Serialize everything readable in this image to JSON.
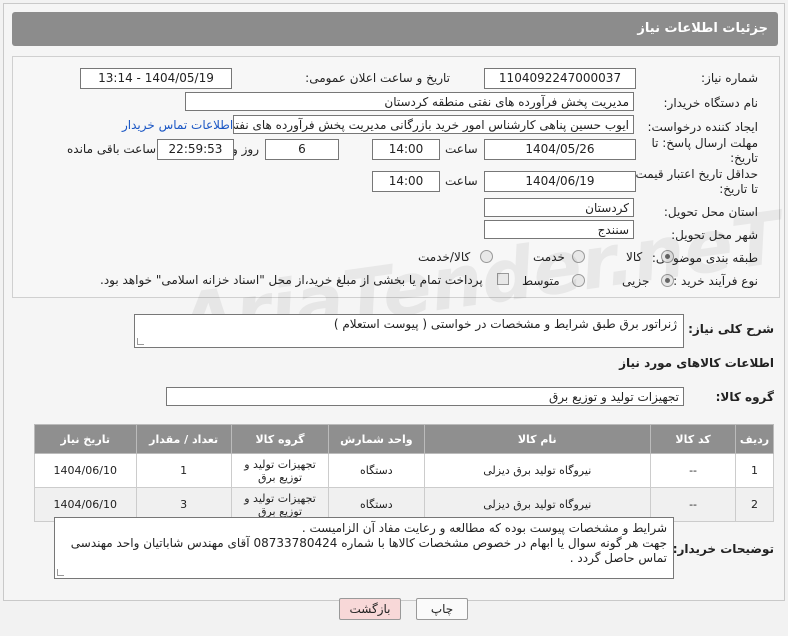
{
  "header": {
    "title": "جزئیات اطلاعات نیاز"
  },
  "form": {
    "need_number_label": "شماره نیاز:",
    "need_number": "1104092247000037",
    "announce_label": "تاریخ و ساعت اعلان عمومی:",
    "announce_value": "1404/05/19 - 13:14",
    "buyer_org_label": "نام دستگاه خریدار:",
    "buyer_org": "مدیریت پخش فرآورده های نفتی منطقه کردستان",
    "creator_label": "ایجاد کننده درخواست:",
    "creator": "ایوب حسین پناهی کارشناس امور خرید بازرگانی مدیریت پخش فرآورده های نفتی",
    "contact_link": "اطلاعات تماس خریدار",
    "deadline_label_1": "مهلت ارسال پاسخ: تا",
    "deadline_label_2": "تاریخ:",
    "deadline_date": "1404/05/26",
    "time_label": "ساعت",
    "deadline_time": "14:00",
    "days_value": "6",
    "days_label": "روز و",
    "remaining_time": "22:59:53",
    "remaining_label": "ساعت باقی مانده",
    "min_price_label_1": "حداقل تاریخ اعتبار قیمت:",
    "min_price_label_2": "تا تاریخ:",
    "min_price_date": "1404/06/19",
    "min_price_time": "14:00",
    "province_label": "استان محل تحویل:",
    "province": "کردستان",
    "city_label": "شهر محل تحویل:",
    "city": "سنندج",
    "category_label": "طبقه بندی موضوعی:",
    "category_options": [
      "کالا",
      "خدمت",
      "کالا/خدمت"
    ],
    "process_label": "نوع فرآیند خرید :",
    "process_options": [
      "جزیی",
      "متوسط"
    ],
    "payment_note": "پرداخت تمام یا بخشی از مبلغ خرید،از محل \"اسناد خزانه اسلامی\" خواهد بود."
  },
  "description": {
    "label": "شرح کلی نیاز:",
    "text": "ژنراتور برق طبق شرایط و مشخصات در خواستی  (  پیوست استعلام )"
  },
  "goods": {
    "section_title": "اطلاعات کالاهای مورد نیاز",
    "group_label": "گروه کالا:",
    "group_value": "تجهیزات تولید و توزیع برق",
    "columns": [
      "ردیف",
      "کد کالا",
      "نام کالا",
      "واحد شمارش",
      "گروه کالا",
      "تعداد / مقدار",
      "تاریخ نیاز"
    ],
    "rows": [
      {
        "row": "1",
        "code": "--",
        "name": "نیروگاه تولید برق دیزلی",
        "unit": "دستگاه",
        "group": "تجهیزات تولید و توزیع برق",
        "qty": "1",
        "date": "1404/06/10"
      },
      {
        "row": "2",
        "code": "--",
        "name": "نیروگاه تولید برق دیزلی",
        "unit": "دستگاه",
        "group": "تجهیزات تولید و توزیع برق",
        "qty": "3",
        "date": "1404/06/10"
      }
    ]
  },
  "buyer_notes": {
    "label": "توضیحات خریدار:",
    "line1": "شرایط و مشخصات پیوست بوده که مطالعه و رعایت مفاد آن الزامیست .",
    "line2": "جهت هر گونه سوال یا ابهام در خصوص مشخصات کالاها با شماره 08733780424 آقای مهندس شاباتیان واحد مهندسی",
    "line3": "تماس حاصل گردد ."
  },
  "buttons": {
    "print": "چاپ",
    "back": "بازگشت"
  },
  "watermark": "AriaTender.neT"
}
